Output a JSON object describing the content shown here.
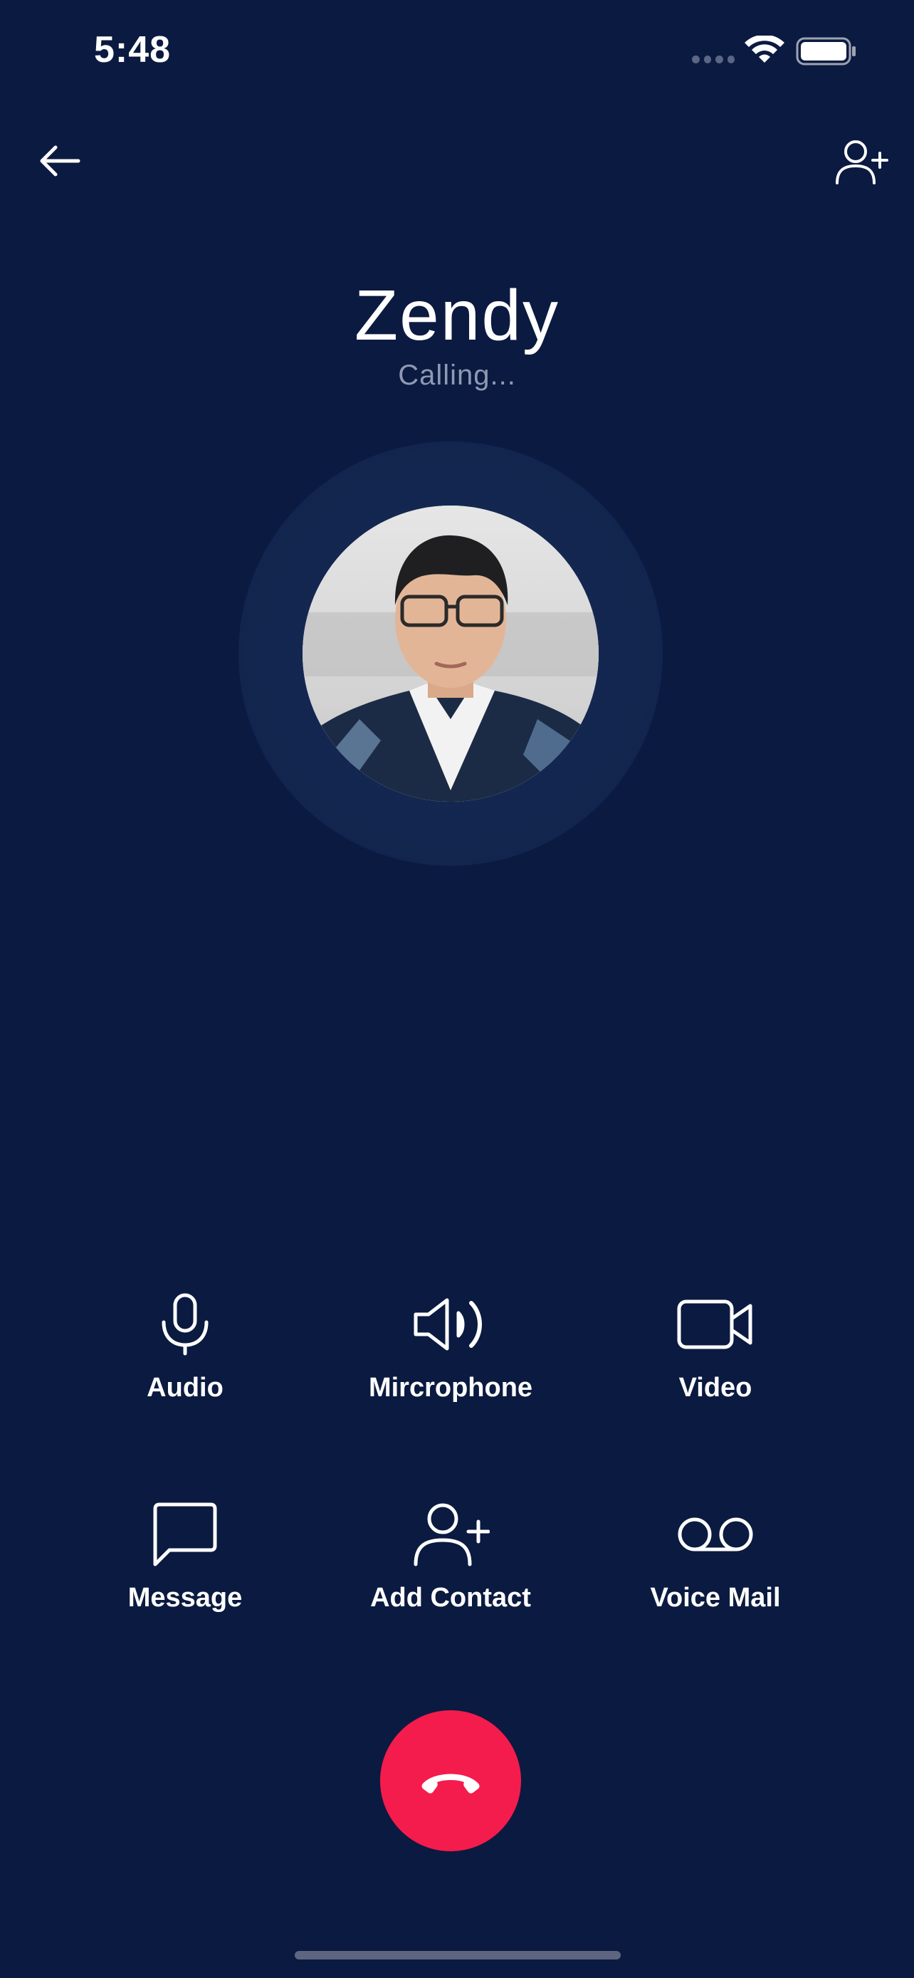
{
  "status_bar": {
    "time": "5:48",
    "icons": [
      "signal-dots-icon",
      "wifi-icon",
      "battery-icon"
    ]
  },
  "header": {
    "back_icon": "arrow-left-icon",
    "add_contact_icon": "user-plus-icon"
  },
  "contact": {
    "name": "Zendy",
    "status": "Calling..."
  },
  "actions": [
    {
      "label": "Audio",
      "icon": "microphone-icon"
    },
    {
      "label": "Mircrophone",
      "icon": "speaker-icon"
    },
    {
      "label": "Video",
      "icon": "video-camera-icon"
    },
    {
      "label": "Message",
      "icon": "message-bubble-icon"
    },
    {
      "label": "Add Contact",
      "icon": "user-plus-icon"
    },
    {
      "label": "Voice Mail",
      "icon": "voicemail-icon"
    }
  ],
  "end_call": {
    "icon": "phone-hangup-icon"
  },
  "colors": {
    "background": "#0b1a40",
    "end_call": "#f41c4c",
    "status_text": "#8f99b3"
  }
}
